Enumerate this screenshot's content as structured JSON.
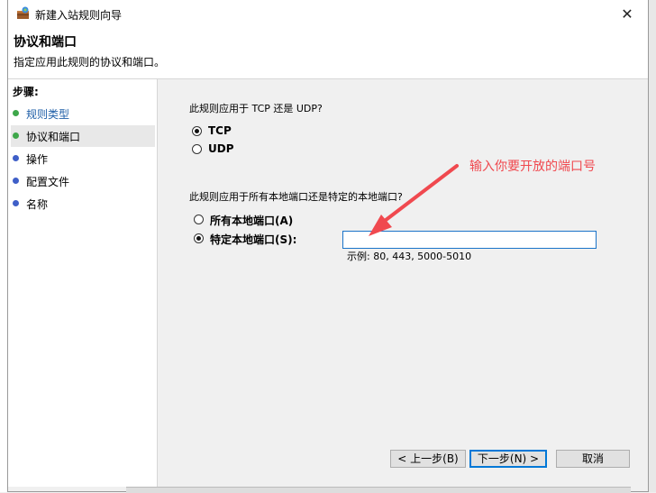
{
  "window": {
    "title": "新建入站规则向导",
    "close_glyph": "✕"
  },
  "header": {
    "title": "协议和端口",
    "subtitle": "指定应用此规则的协议和端口。"
  },
  "steps": {
    "title": "步骤:",
    "items": [
      {
        "label": "规则类型",
        "dot_color": "#3ea74a",
        "label_color": "#1f5fa8"
      },
      {
        "label": "协议和端口",
        "dot_color": "#3ea74a",
        "label_color": "#000000"
      },
      {
        "label": "操作",
        "dot_color": "#3f5fc8",
        "label_color": "#000000"
      },
      {
        "label": "配置文件",
        "dot_color": "#3f5fc8",
        "label_color": "#000000"
      },
      {
        "label": "名称",
        "dot_color": "#3f5fc8",
        "label_color": "#000000"
      }
    ]
  },
  "protocol": {
    "question": "此规则应用于 TCP 还是 UDP?",
    "options": [
      {
        "label": "TCP",
        "selected": true
      },
      {
        "label": "UDP",
        "selected": false
      }
    ]
  },
  "ports": {
    "question": "此规则应用于所有本地端口还是特定的本地端口?",
    "options": [
      {
        "label": "所有本地端口(A)",
        "selected": false
      },
      {
        "label": "特定本地端口(S):",
        "selected": true
      }
    ],
    "value": "",
    "example": "示例: 80, 443, 5000-5010"
  },
  "annotation": {
    "text": "输入你要开放的端口号",
    "color": "#f0494f"
  },
  "buttons": {
    "back": "< 上一步(B)",
    "next": "下一步(N) >",
    "cancel": "取消"
  }
}
